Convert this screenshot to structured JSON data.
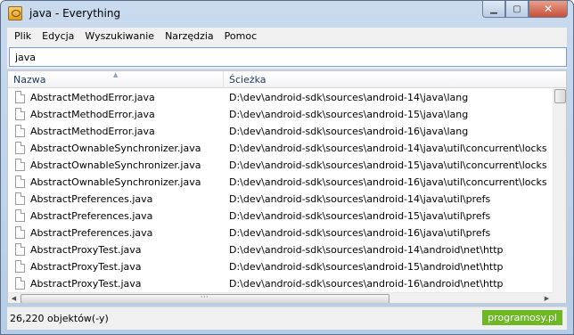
{
  "window": {
    "title": "java - Everything",
    "buttons": {
      "minimize": "▁",
      "maximize": "▢",
      "close": "✕"
    }
  },
  "menu": {
    "items": [
      {
        "label": "Plik"
      },
      {
        "label": "Edycja"
      },
      {
        "label": "Wyszukiwanie"
      },
      {
        "label": "Narzędzia"
      },
      {
        "label": "Pomoc"
      }
    ]
  },
  "search": {
    "value": "java"
  },
  "list": {
    "columns": {
      "name": "Nazwa",
      "path": "Ścieżka",
      "sort_indicator": "^"
    },
    "rows": [
      {
        "name": "AbstractMethodError.java",
        "path": "D:\\dev\\android-sdk\\sources\\android-14\\java\\lang"
      },
      {
        "name": "AbstractMethodError.java",
        "path": "D:\\dev\\android-sdk\\sources\\android-15\\java\\lang"
      },
      {
        "name": "AbstractMethodError.java",
        "path": "D:\\dev\\android-sdk\\sources\\android-16\\java\\lang"
      },
      {
        "name": "AbstractOwnableSynchronizer.java",
        "path": "D:\\dev\\android-sdk\\sources\\android-14\\java\\util\\concurrent\\locks"
      },
      {
        "name": "AbstractOwnableSynchronizer.java",
        "path": "D:\\dev\\android-sdk\\sources\\android-15\\java\\util\\concurrent\\locks"
      },
      {
        "name": "AbstractOwnableSynchronizer.java",
        "path": "D:\\dev\\android-sdk\\sources\\android-16\\java\\util\\concurrent\\locks"
      },
      {
        "name": "AbstractPreferences.java",
        "path": "D:\\dev\\android-sdk\\sources\\android-14\\java\\util\\prefs"
      },
      {
        "name": "AbstractPreferences.java",
        "path": "D:\\dev\\android-sdk\\sources\\android-15\\java\\util\\prefs"
      },
      {
        "name": "AbstractPreferences.java",
        "path": "D:\\dev\\android-sdk\\sources\\android-16\\java\\util\\prefs"
      },
      {
        "name": "AbstractProxyTest.java",
        "path": "D:\\dev\\android-sdk\\sources\\android-14\\android\\net\\http"
      },
      {
        "name": "AbstractProxyTest.java",
        "path": "D:\\dev\\android-sdk\\sources\\android-15\\android\\net\\http"
      },
      {
        "name": "AbstractProxyTest.java",
        "path": "D:\\dev\\android-sdk\\sources\\android-16\\android\\net\\http"
      }
    ]
  },
  "status": {
    "text": "26,220 objektów(-y)"
  },
  "watermark": {
    "text": "programosy.pl"
  }
}
